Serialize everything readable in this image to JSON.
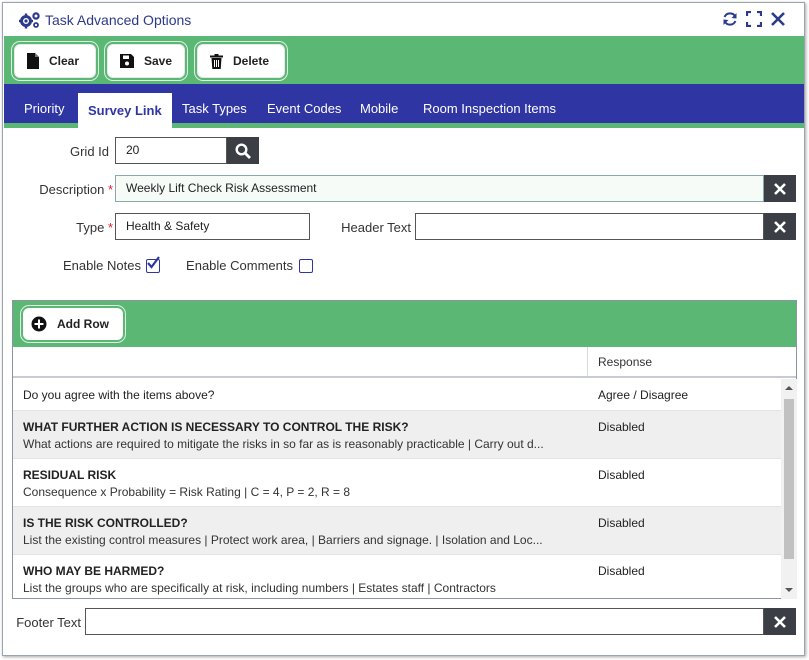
{
  "window": {
    "title": "Task Advanced Options",
    "icons": {
      "title": "gears-icon",
      "refresh": "refresh-icon",
      "maximize": "expand-icon",
      "close": "close-icon"
    }
  },
  "toolbar": {
    "clear_label": "Clear",
    "save_label": "Save",
    "delete_label": "Delete"
  },
  "tabs": [
    {
      "label": "Priority",
      "active": false
    },
    {
      "label": "Survey Link",
      "active": true
    },
    {
      "label": "Task Types",
      "active": false
    },
    {
      "label": "Event Codes",
      "active": false
    },
    {
      "label": "Mobile",
      "active": false
    },
    {
      "label": "Room Inspection Items",
      "active": false
    }
  ],
  "form": {
    "grid_id_label": "Grid Id",
    "grid_id_value": "20",
    "description_label": "Description",
    "description_value": "Weekly Lift Check Risk Assessment",
    "required_mark": "*",
    "type_label": "Type",
    "type_value": "Health & Safety",
    "header_text_label": "Header Text",
    "header_text_value": "",
    "enable_notes_label": "Enable Notes",
    "enable_notes_checked": true,
    "enable_comments_label": "Enable Comments",
    "enable_comments_checked": false
  },
  "grid": {
    "add_row_label": "Add Row",
    "columns": {
      "question": "",
      "response": "Response"
    },
    "rows": [
      {
        "title": "Do you agree with the items above?",
        "description": "",
        "response": "Agree / Disagree",
        "bold": false
      },
      {
        "title": "WHAT FURTHER ACTION IS NECESSARY TO CONTROL THE RISK?",
        "description": "What actions are required to mitigate the risks in so far as is reasonably practicable | Carry out d...",
        "response": "Disabled",
        "bold": true
      },
      {
        "title": "RESIDUAL RISK",
        "description": "Consequence x Probability = Risk Rating | C = 4, P = 2, R = 8",
        "response": "Disabled",
        "bold": true
      },
      {
        "title": "IS THE RISK CONTROLLED?",
        "description": "List the existing control measures | Protect work area, | Barriers and signage. | Isolation and Loc...",
        "response": "Disabled",
        "bold": true
      },
      {
        "title": "WHO MAY BE HARMED?",
        "description": "List the groups who are specifically at risk, including numbers | Estates staff | Contractors",
        "response": "Disabled",
        "bold": true
      }
    ]
  },
  "footer": {
    "footer_text_label": "Footer Text",
    "footer_text_value": ""
  },
  "colors": {
    "green": "#5ab874",
    "navy": "#2f36a3",
    "title": "#2c3a8c",
    "required": "#d9232e",
    "dark_button": "#3b3f45"
  }
}
